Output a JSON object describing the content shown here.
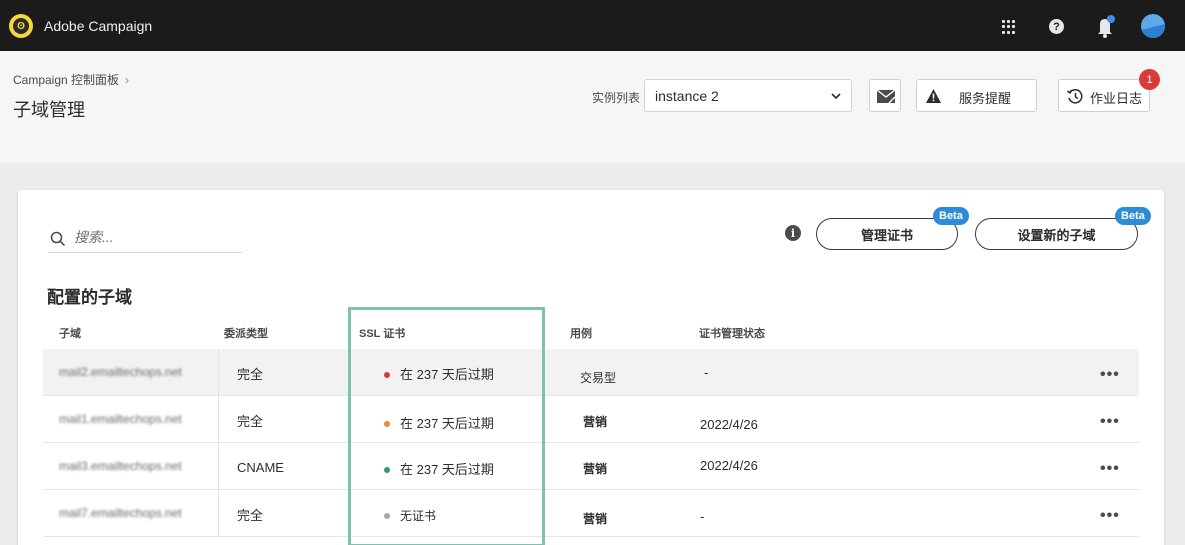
{
  "app": {
    "title": "Adobe Campaign"
  },
  "colors": {
    "highlight": "#7ec1b0",
    "badge_red": "#d93a3a",
    "beta_blue": "#2d8cd6",
    "dot_red": "#d93a3a",
    "dot_orange": "#e08a3a",
    "dot_green": "#2d9d6b",
    "dot_gray": "#a8a8a8"
  },
  "header": {
    "breadcrumb": "Campaign 控制面板",
    "title": "子域管理",
    "instance_label": "实例列表",
    "instance_value": "instance 2",
    "alerts_label": "服务提醒",
    "joblog_label": "作业日志",
    "notification_count": "1"
  },
  "toolbar": {
    "search_placeholder": "搜索...",
    "manage_cert_label": "管理证书",
    "setup_subdomain_label": "设置新的子域",
    "beta": "Beta"
  },
  "table": {
    "title": "配置的子域",
    "columns": [
      "子域",
      "委派类型",
      "SSL 证书",
      "用例",
      "证书管理状态"
    ],
    "rows": [
      {
        "subdomain": "mail2.emailtechops.net",
        "delegation": "完全",
        "ssl": "在 237 天后过期",
        "ssl_status": "red",
        "use_case": "交易型",
        "cert_status": "-"
      },
      {
        "subdomain": "mail1.emailtechops.net",
        "delegation": "完全",
        "ssl": "在 237 天后过期",
        "ssl_status": "orange",
        "use_case": "营销",
        "cert_status": "2022/4/26"
      },
      {
        "subdomain": "mail3.emailtechops.net",
        "delegation": "CNAME",
        "ssl": "在 237 天后过期",
        "ssl_status": "green",
        "use_case": "营销",
        "cert_status": "2022/4/26"
      },
      {
        "subdomain": "mail7.emailtechops.net",
        "delegation": "完全",
        "ssl": "无证书",
        "ssl_status": "gray",
        "use_case": "营销",
        "cert_status": "-"
      }
    ],
    "more_label": "•••"
  }
}
